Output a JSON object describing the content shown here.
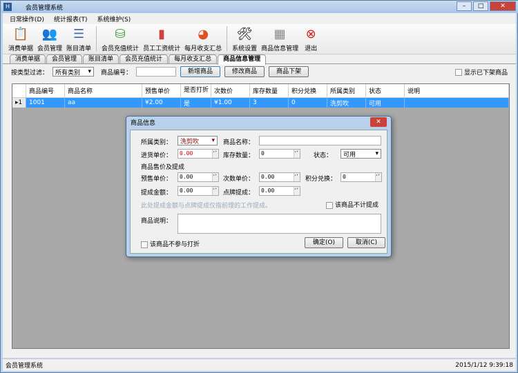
{
  "window": {
    "title": "会员管理系统"
  },
  "menu": [
    "日常操作(D)",
    "统计报表(T)",
    "系统维护(S)"
  ],
  "toolbar": [
    {
      "label": "消费单据",
      "icon": "clipboard-icon"
    },
    {
      "label": "会员管理",
      "icon": "users-icon"
    },
    {
      "label": "账目清单",
      "icon": "list-icon"
    },
    {
      "label": "会员充值统计",
      "icon": "database-add-icon"
    },
    {
      "label": "员工工资统计",
      "icon": "bar-chart-icon"
    },
    {
      "label": "每月收支汇总",
      "icon": "pie-chart-icon"
    },
    {
      "label": "系统设置",
      "icon": "tools-icon"
    },
    {
      "label": "商品信息管理",
      "icon": "grid-icon"
    },
    {
      "label": "退出",
      "icon": "exit-icon"
    }
  ],
  "tabs": [
    "消费单据",
    "会员管理",
    "账目清单",
    "会员充值统计",
    "每月收支汇总",
    "商品信息管理"
  ],
  "filter": {
    "type_label": "按类型过滤：",
    "type_value": "所有类别",
    "code_label": "商品编号：",
    "code_value": "",
    "add": "新增商品",
    "edit": "修改商品",
    "remove": "商品下架",
    "show_removed": "显示已下架商品"
  },
  "grid": {
    "columns": [
      "商品编号",
      "商品名称",
      "预售单价",
      "是否打折",
      "次数价",
      "库存数量",
      "积分兑换",
      "所属类别",
      "状态",
      "说明"
    ],
    "rows": [
      {
        "index": "1",
        "cells": [
          "1001",
          "aa",
          "¥2.00",
          "是",
          "¥1.00",
          "3",
          "0",
          "洗剪吹",
          "可用",
          ""
        ]
      }
    ]
  },
  "dialog": {
    "title": "商品信息",
    "category_label": "所属类别：",
    "category": "洗剪吹",
    "name_label": "商品名称：",
    "name": "",
    "cost_label": "进货单价：",
    "cost": "0.00",
    "stock_label": "库存数量：",
    "stock": "0",
    "status_label": "状态：",
    "status": "可用",
    "section": "商品售价及提成",
    "price_label": "预售单价：",
    "price": "0.00",
    "times_label": "次数单价：",
    "times": "0.00",
    "points_label": "积分兑换：",
    "points": "0",
    "commission_label": "提成金额：",
    "commission": "0.00",
    "clock_label": "点牌提成：",
    "clock": "0.00",
    "hint": "此处提成金额与点牌提成仅指前理的工作提成。",
    "no_commission": "该商品不计提成",
    "desc_label": "商品说明：",
    "desc": "",
    "no_discount": "该商品不参与打折",
    "ok": "确定(O)",
    "cancel": "取消(C)"
  },
  "status": {
    "left": "会员管理系统",
    "right": "2015/1/12 9:39:18"
  }
}
